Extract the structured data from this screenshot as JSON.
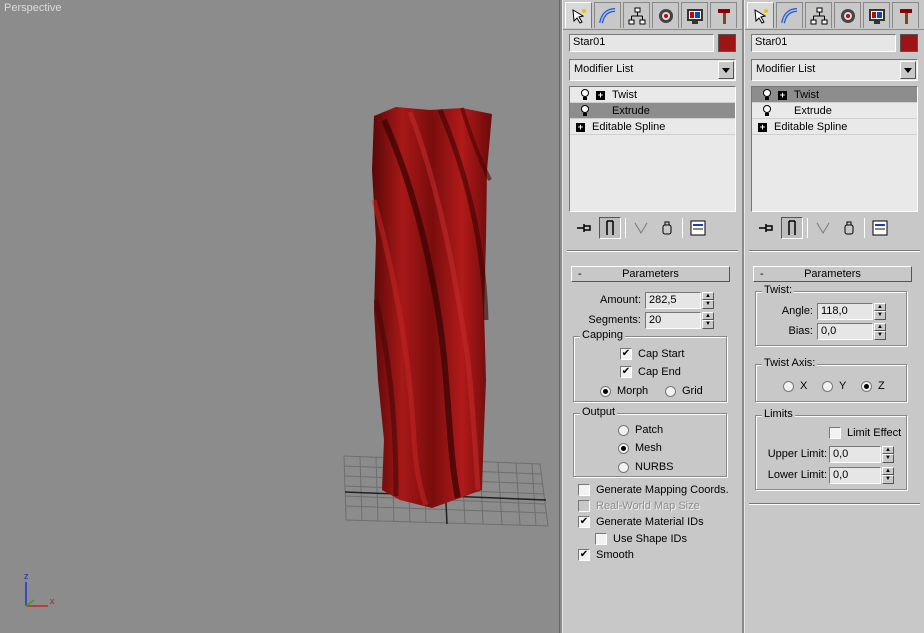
{
  "viewport": {
    "label": "Perspective",
    "axis_x": "x",
    "axis_z": "z"
  },
  "colors": {
    "object": "#9e1414",
    "viewport_bg": "#8c8c8c",
    "panel_bg": "#c8c8c8"
  },
  "tab_icons": [
    "pointer-icon",
    "curve-icon",
    "hierarchy-icon",
    "motion-icon",
    "display-icon",
    "utilities-hammer-icon"
  ],
  "left_panel": {
    "object_name": "Star01",
    "modifier_list": "Modifier List",
    "stack": [
      {
        "label": "Twist",
        "selected": false
      },
      {
        "label": "Extrude",
        "selected": true
      },
      {
        "label": "Editable Spline",
        "selected": false
      }
    ],
    "rollout_title": "Parameters",
    "amount_label": "Amount:",
    "amount_value": "282,5",
    "segments_label": "Segments:",
    "segments_value": "20",
    "capping_title": "Capping",
    "cap_start": "Cap Start",
    "cap_end": "Cap End",
    "morph": "Morph",
    "grid": "Grid",
    "output_title": "Output",
    "patch": "Patch",
    "mesh": "Mesh",
    "nurbs": "NURBS",
    "gen_mapping": "Generate Mapping Coords.",
    "real_world": "Real-World Map Size",
    "gen_material": "Generate Material IDs",
    "use_shape": "Use Shape IDs",
    "smooth": "Smooth"
  },
  "right_panel": {
    "object_name": "Star01",
    "modifier_list": "Modifier List",
    "stack": [
      {
        "label": "Twist",
        "selected": true
      },
      {
        "label": "Extrude",
        "selected": false
      },
      {
        "label": "Editable Spline",
        "selected": false
      }
    ],
    "rollout_title": "Parameters",
    "twist_title": "Twist:",
    "angle_label": "Angle:",
    "angle_value": "118,0",
    "bias_label": "Bias:",
    "bias_value": "0,0",
    "axis_title": "Twist Axis:",
    "axis_x": "X",
    "axis_y": "Y",
    "axis_z": "Z",
    "limits_title": "Limits",
    "limit_effect": "Limit Effect",
    "upper_label": "Upper Limit:",
    "upper_value": "0,0",
    "lower_label": "Lower Limit:",
    "lower_value": "0,0"
  }
}
